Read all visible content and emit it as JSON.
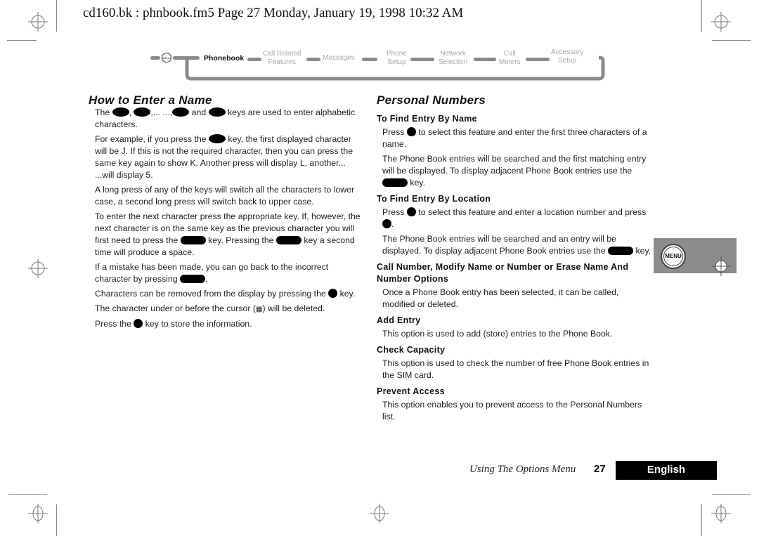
{
  "header": {
    "slug": "cd160.bk : phnbook.fm5  Page 27  Monday, January 19, 1998  10:32 AM"
  },
  "nav": {
    "menu_label": "MENU",
    "items": [
      {
        "line1": "Phonebook",
        "line2": "",
        "active": true
      },
      {
        "line1": "Call Related",
        "line2": "Features",
        "active": false
      },
      {
        "line1": "Messages",
        "line2": "",
        "active": false
      },
      {
        "line1": "Phone",
        "line2": "Setup",
        "active": false
      },
      {
        "line1": "Network",
        "line2": "Selection",
        "active": false
      },
      {
        "line1": "Call",
        "line2": "Meters",
        "active": false
      },
      {
        "line1": "Accessory",
        "line2": "Setup",
        "active": false
      }
    ]
  },
  "left": {
    "title": "How to Enter a Name",
    "p1": {
      "a": "The",
      "b": ",",
      "c": ",... ...,",
      "d": "and",
      "e": "keys are used to enter alphabetic characters."
    },
    "p2": {
      "a": "For example, if you press the",
      "b": "key, the first displayed character will be J. If this is not the required character, then you can press the same key again to show K. Another press will display L, another...  ...will display 5."
    },
    "p3": "A long press of any of the keys will switch all the characters to lower case, a second long press will switch back to upper case.",
    "p4": {
      "a": "To enter the next character press the appropriate key. If, however, the next character is on the same key as the previous character you will first need to press the",
      "b": "key. Pressing the",
      "c": "key a second time will produce a space."
    },
    "p5": {
      "a": "If a mistake has been made, you can go back to the incorrect character by pressing",
      "b": "."
    },
    "p6": {
      "a": "Characters can be removed from the display by pressing the",
      "b": "key."
    },
    "p7": {
      "a": "The character under or before the cursor (",
      "cursor": "▦",
      "b": ") will be deleted."
    },
    "p8": {
      "a": "Press the",
      "b": "key to store the information."
    }
  },
  "right": {
    "title": "Personal Numbers",
    "s1": {
      "heading": "To Find Entry By Name",
      "p1a": "Press",
      "p1b": "to select this feature and enter the first three characters of a name.",
      "p2a": "The Phone Book entries will be searched and the first matching entry will be displayed. To display adjacent Phone Book entries use the",
      "p2b": "key."
    },
    "s2": {
      "heading": "To Find Entry By Location",
      "p1a": "Press",
      "p1b": "to select this feature and enter a location number and press",
      "p1c": ".",
      "p2a": "The Phone Book entries will be searched and an entry will be displayed. To display adjacent Phone Book entries use the",
      "p2b": "key."
    },
    "s3": {
      "heading": "Call Number, Modify Name or Number or Erase Name And Number Options",
      "p1": "Once a Phone Book entry has been selected, it can be called, modified or deleted."
    },
    "s4": {
      "heading": "Add Entry",
      "p1": "This option is used to add (store) entries to the Phone Book."
    },
    "s5": {
      "heading": "Check Capacity",
      "p1": "This option is used to check the number of free Phone Book entries in the SIM card."
    },
    "s6": {
      "heading": "Prevent Access",
      "p1": "This option enables you to prevent access to the Personal Numbers list."
    }
  },
  "side_tab": {
    "label": "MENU"
  },
  "footer": {
    "section": "Using The Options Menu",
    "page": "27",
    "language": "English"
  }
}
